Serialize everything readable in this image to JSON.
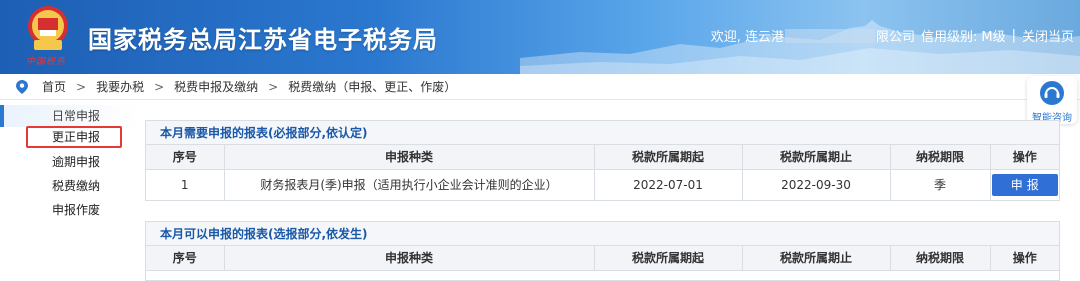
{
  "header": {
    "title": "国家税务总局江苏省电子税务局",
    "logo_text": "中国税务",
    "welcome_prefix": "欢迎, 连云港",
    "welcome_suffix": "限公司",
    "credit_label": "信用级别:",
    "credit_value": "M级",
    "separator": "|",
    "close_label": "关闭当页"
  },
  "breadcrumb": {
    "items": [
      "首页",
      "我要办税",
      "税费申报及缴纳",
      "税费缴纳（申报、更正、作废）"
    ],
    "arrow": ">"
  },
  "sidebar": {
    "items": [
      {
        "label": "日常申报"
      },
      {
        "label": "更正申报"
      },
      {
        "label": "逾期申报"
      },
      {
        "label": "税费缴纳"
      },
      {
        "label": "申报作废"
      }
    ]
  },
  "assistant": {
    "label": "智能咨询"
  },
  "required_panel": {
    "title": "本月需要申报的报表(必报部分,依认定)",
    "columns": [
      "序号",
      "申报种类",
      "税款所属期起",
      "税款所属期止",
      "纳税期限",
      "操作"
    ],
    "rows": [
      {
        "index": "1",
        "type": "财务报表月(季)申报（适用执行小企业会计准则的企业）",
        "start": "2022-07-01",
        "end": "2022-09-30",
        "period": "季",
        "action": "申报"
      }
    ]
  },
  "optional_panel": {
    "title": "本月可以申报的报表(选报部分,依发生)",
    "columns": [
      "序号",
      "申报种类",
      "税款所属期起",
      "税款所属期止",
      "纳税期限",
      "操作"
    ]
  },
  "colors": {
    "accent": "#2b78d0",
    "button": "#2f6fd6",
    "highlight_box": "#e53935"
  }
}
